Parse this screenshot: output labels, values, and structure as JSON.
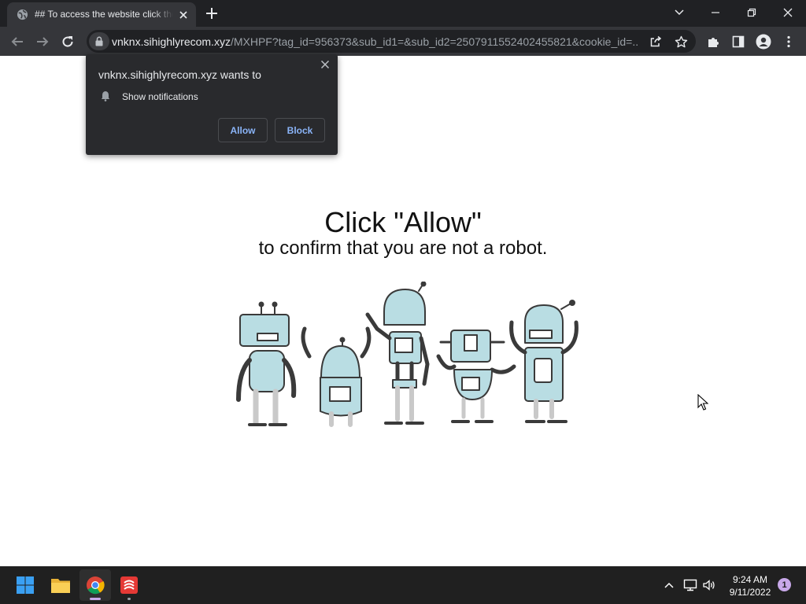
{
  "browser": {
    "tab_title": "## To access the website click the Allow button",
    "url_host": "vnknx.sihighlyrecom.xyz",
    "url_path": "/MXHPF?tag_id=956373&sub_id1=&sub_id2=2507911552402455821&cookie_id=..."
  },
  "permission_popup": {
    "title": "vnknx.sihighlyrecom.xyz wants to",
    "permission": "Show notifications",
    "allow_label": "Allow",
    "block_label": "Block"
  },
  "page": {
    "headline": "Click \"Allow\"",
    "subline": "to confirm that you are not a robot."
  },
  "taskbar": {
    "apps": [
      "start-icon",
      "file-explorer-icon",
      "chrome-icon",
      "app-icon"
    ],
    "time": "9:24 AM",
    "date": "9/11/2022",
    "notification_count": "1"
  },
  "colors": {
    "browser_frame": "#202124",
    "toolbar": "#35363a",
    "popup_bg": "#292a2d",
    "popup_button_text": "#8ab4f8",
    "taskbar": "#202020",
    "robot_fill": "#b9dde3"
  }
}
